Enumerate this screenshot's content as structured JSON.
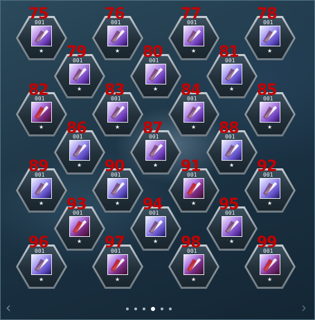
{
  "slots": [
    {
      "number": "75",
      "code": "001",
      "star": "★"
    },
    {
      "number": "76",
      "code": "001",
      "star": "★"
    },
    {
      "number": "77",
      "code": "001",
      "star": "★"
    },
    {
      "number": "78",
      "code": "001",
      "star": "★"
    },
    {
      "number": "79",
      "code": "001",
      "star": "★"
    },
    {
      "number": "80",
      "code": "001",
      "star": "★"
    },
    {
      "number": "81",
      "code": "001",
      "star": "★"
    },
    {
      "number": "82",
      "code": "001",
      "star": "★"
    },
    {
      "number": "83",
      "code": "001",
      "star": "★"
    },
    {
      "number": "84",
      "code": "001",
      "star": "★"
    },
    {
      "number": "85",
      "code": "001",
      "star": "★"
    },
    {
      "number": "86",
      "code": "001",
      "star": "★"
    },
    {
      "number": "87",
      "code": "001",
      "star": "★"
    },
    {
      "number": "88",
      "code": "001",
      "star": "★"
    },
    {
      "number": "89",
      "code": "001",
      "star": "★"
    },
    {
      "number": "90",
      "code": "001",
      "star": "★"
    },
    {
      "number": "91",
      "code": "001",
      "star": "★"
    },
    {
      "number": "92",
      "code": "001",
      "star": "★"
    },
    {
      "number": "93",
      "code": "001",
      "star": "★"
    },
    {
      "number": "94",
      "code": "001",
      "star": "★"
    },
    {
      "number": "95",
      "code": "001",
      "star": "★"
    },
    {
      "number": "96",
      "code": "001",
      "star": "★"
    },
    {
      "number": "97",
      "code": "001",
      "star": "★"
    },
    {
      "number": "98",
      "code": "001",
      "star": "★"
    },
    {
      "number": "99",
      "code": "001",
      "star": "★"
    }
  ],
  "pagination": {
    "pages": 6,
    "current_page": 4
  },
  "nav": {
    "prev_icon": "chevron-left-icon",
    "next_icon": "chevron-right-icon",
    "prev_glyph": "‹",
    "next_glyph": "›"
  },
  "colors": {
    "number_red": "#c40000",
    "hex_frame": "#8b959c",
    "background": "#213b4c"
  }
}
